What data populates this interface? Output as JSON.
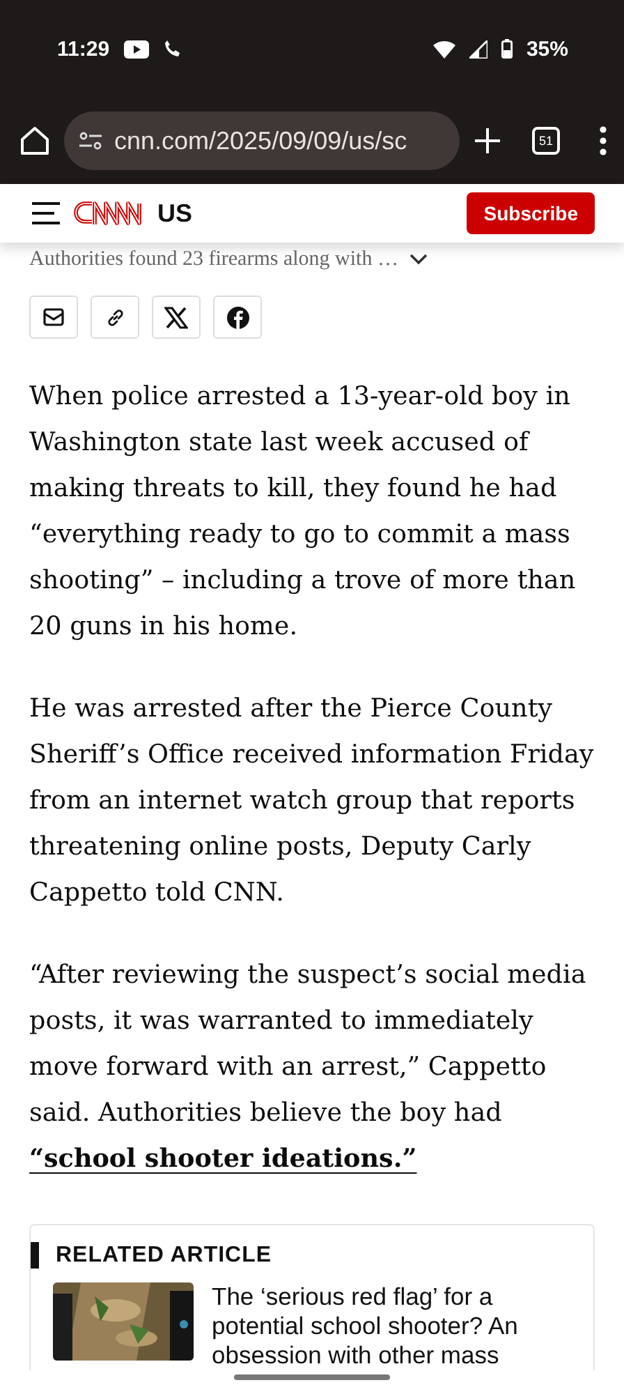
{
  "status_bar": {
    "time": "11:29",
    "battery": "35%"
  },
  "browser": {
    "url": "cnn.com/2025/09/09/us/sc",
    "tab_count": "51"
  },
  "header": {
    "section": "US",
    "subscribe": "Subscribe"
  },
  "subtitle": "Authorities found 23 firearms along with …",
  "share_buttons": [
    {
      "kind": "email"
    },
    {
      "kind": "link"
    },
    {
      "kind": "x"
    },
    {
      "kind": "facebook"
    }
  ],
  "paragraphs": [
    "When police arrested a 13-year-old boy in Washington state last week accused of making threats to kill, they found he had “everything ready to go to commit a mass shooting” – including a trove of more than 20 guns in his home.",
    "He was arrested after the Pierce County Sheriff’s Office received information Friday from an internet watch group that reports threatening online posts, Deputy Carly Cappetto told CNN.",
    "“After reviewing the suspect’s social media posts, it was warranted to immediately move forward with an arrest,” Cappetto said. Authorities believe the boy had"
  ],
  "paragraph_link": "“school shooter ideations.”",
  "related": {
    "label": "RELATED ARTICLE",
    "title": "The ‘serious red flag’ for a potential school shooter? An obsession with other mass"
  }
}
